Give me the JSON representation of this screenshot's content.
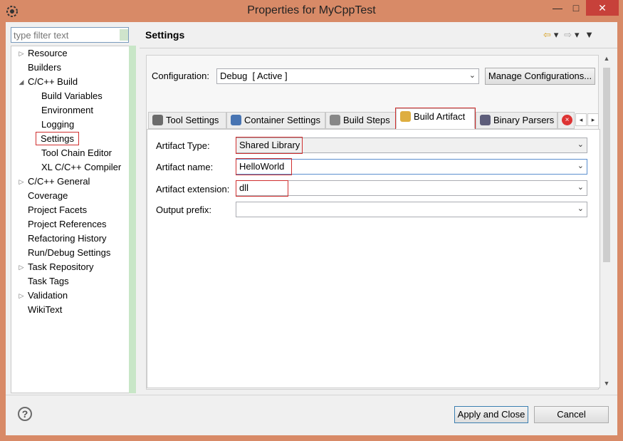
{
  "window": {
    "title": "Properties for MyCppTest",
    "colors": {
      "frame": "#d88a67",
      "close": "#c7413a"
    },
    "controls": {
      "minimize": "—",
      "maximize": "□",
      "close": "✕"
    }
  },
  "filter": {
    "placeholder": "type filter text"
  },
  "tree": {
    "items": [
      {
        "label": "Resource",
        "expandable": true
      },
      {
        "label": "Builders",
        "expandable": false
      },
      {
        "label": "C/C++ Build",
        "expandable": true,
        "expanded": true
      },
      {
        "label": "Build Variables",
        "expandable": false
      },
      {
        "label": "Environment",
        "expandable": false
      },
      {
        "label": "Logging",
        "expandable": false
      },
      {
        "label": "Settings",
        "expandable": false,
        "selected": true
      },
      {
        "label": "Tool Chain Editor",
        "expandable": false
      },
      {
        "label": "XL C/C++ Compiler",
        "expandable": false
      },
      {
        "label": "C/C++ General",
        "expandable": true
      },
      {
        "label": "Coverage",
        "expandable": false
      },
      {
        "label": "Project Facets",
        "expandable": false
      },
      {
        "label": "Project References",
        "expandable": false
      },
      {
        "label": "Refactoring History",
        "expandable": false
      },
      {
        "label": "Run/Debug Settings",
        "expandable": false
      },
      {
        "label": "Task Repository",
        "expandable": true
      },
      {
        "label": "Task Tags",
        "expandable": false
      },
      {
        "label": "Validation",
        "expandable": true
      },
      {
        "label": "WikiText",
        "expandable": false
      }
    ]
  },
  "page": {
    "title": "Settings"
  },
  "configuration": {
    "label": "Configuration:",
    "value": "Debug  [ Active ]",
    "manage_button": "Manage Configurations..."
  },
  "tabs": [
    {
      "label": "Tool Settings",
      "icon": "tool-settings-icon"
    },
    {
      "label": "Container Settings",
      "icon": "container-icon"
    },
    {
      "label": "Build Steps",
      "icon": "build-steps-icon"
    },
    {
      "label": "Build Artifact",
      "icon": "trophy-icon",
      "active": true
    },
    {
      "label": "Binary Parsers",
      "icon": "binary-parsers-icon"
    },
    {
      "label": "",
      "icon": "error-icon"
    }
  ],
  "artifact": {
    "type_label": "Artifact Type:",
    "type_value": "Shared Library",
    "name_label": "Artifact name:",
    "name_value": "HelloWorld",
    "extension_label": "Artifact extension:",
    "extension_value": "dll",
    "prefix_label": "Output prefix:",
    "prefix_value": ""
  },
  "footer": {
    "apply_close": "Apply and Close",
    "cancel": "Cancel"
  }
}
